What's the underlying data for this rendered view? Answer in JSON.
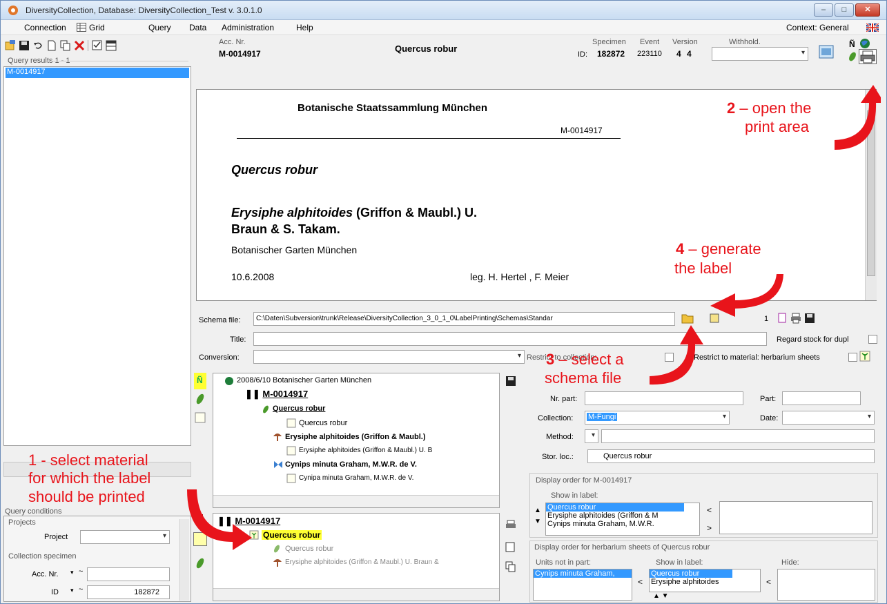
{
  "window": {
    "title": "DiversityCollection,  Database: DiversityCollection_Test   v. 3.0.1.0",
    "min_label": "–",
    "max_label": "□",
    "close_label": "✕"
  },
  "menu": {
    "connection": "Connection",
    "grid": "Grid",
    "query": "Query",
    "data": "Data",
    "administration": "Administration",
    "help": "Help",
    "context": "Context: General"
  },
  "header": {
    "acc_nr_label": "Acc. Nr.",
    "acc_nr_value": "M-0014917",
    "taxon": "Quercus robur",
    "id_label": "ID:",
    "specimen_label": "Specimen",
    "specimen_value": "182872",
    "event_label": "Event",
    "event_value": "223110",
    "version_label": "Version",
    "version_value": "4",
    "version_value2": "4",
    "withhold_label": "Withhold."
  },
  "query_results": {
    "label": "Query results  1 - 1",
    "items": [
      "M-0014917"
    ]
  },
  "label_preview": {
    "institution": "Botanische Staatssammlung München",
    "acc_nr": "M-0014917",
    "taxon": "Quercus robur",
    "organism_name": "Erysiphe alphitoides",
    "organism_author": " (Griffon & Maubl.) U.",
    "organism_author2": "Braun & S. Takam.",
    "locality": "Botanischer Garten München",
    "date": "10.6.2008",
    "collector": "leg. H. Hertel , F. Meier"
  },
  "print_controls": {
    "schema_file_label": "Schema file:",
    "schema_file_value": "C:\\Daten\\Subversion\\trunk\\Release\\DiversityCollection_3_0_1_0\\LabelPrinting\\Schemas\\Standar",
    "page_number": "1",
    "title_label": "Title:",
    "regard_stock": "Regard stock for dupl",
    "conversion_label": "Conversion:",
    "restrict_collection": "Restrict to collection: ",
    "restrict_material": "Restrict to material:  herbarium sheets"
  },
  "tree_top": {
    "items": [
      {
        "text": "2008/6/10 Botanischer Garten München"
      },
      {
        "text": "M-0014917"
      },
      {
        "text": "Quercus robur"
      },
      {
        "text": "Quercus robur"
      },
      {
        "text": "Erysiphe alphitoides (Griffon & Maubl.)"
      },
      {
        "text": "Erysiphe alphitoides (Griffon & Maubl.) U. B"
      },
      {
        "text": "Cynips minuta Graham, M.W.R. de V."
      },
      {
        "text": "Cynipa minuta Graham, M.W.R. de V."
      }
    ]
  },
  "tree_bottom": {
    "items": [
      {
        "text": "M-0014917"
      },
      {
        "text": "Quercus robur"
      },
      {
        "text": "Quercus robur"
      },
      {
        "text": "Erysiphe alphitoides (Griffon & Maubl.) U. Braun &"
      }
    ]
  },
  "part_form": {
    "nr_part_label": "Nr. part:",
    "part_label": "Part:",
    "collection_label": "Collection:",
    "collection_value": "M-Fungi",
    "date_label": "Date:",
    "method_label": "Method:",
    "stor_loc_label": "Stor. loc.:",
    "stor_loc_value": "Quercus robur"
  },
  "display_order": {
    "title": "Display order for M-0014917",
    "show_in_label": "Show in label:",
    "items": [
      "Quercus robur",
      "Erysiphe alphitoides (Griffon & M",
      "Cynips minuta Graham, M.W.R."
    ],
    "btn_left": "<",
    "btn_right": ">"
  },
  "herbarium_order": {
    "title": "Display order for herbarium sheets of Quercus robur",
    "units_not_in_part": "Units not in part:",
    "show_in_label": "Show in label:",
    "hide": "Hide:",
    "units_items": [
      "Cynips minuta Graham,"
    ],
    "show_items": [
      "Quercus robur",
      "Erysiphe alphitoides"
    ],
    "btn_left": "<",
    "btn_left2": "<"
  },
  "query_conditions": {
    "title": "Query conditions",
    "projects": "Projects",
    "project_label": "Project",
    "collection_specimen": "Collection specimen",
    "acc_nr_label": "Acc. Nr.",
    "acc_nr_op": "~",
    "id_label": "ID",
    "id_op": "~",
    "id_value": "182872"
  },
  "annotations": {
    "a1": "1 - select material",
    "a1b": "for which the label",
    "a1c": "should be printed",
    "a2": "2",
    "a2b": " – open the",
    "a2c": "print area",
    "a3": "3",
    "a3b": " – select a",
    "a3c": "schema file",
    "a4": "4",
    "a4b": " – generate",
    "a4c": "the label"
  },
  "colors": {
    "annotation_red": "#e8141b",
    "selection_blue": "#3399ff",
    "highlight_yellow": "#ffff33"
  }
}
